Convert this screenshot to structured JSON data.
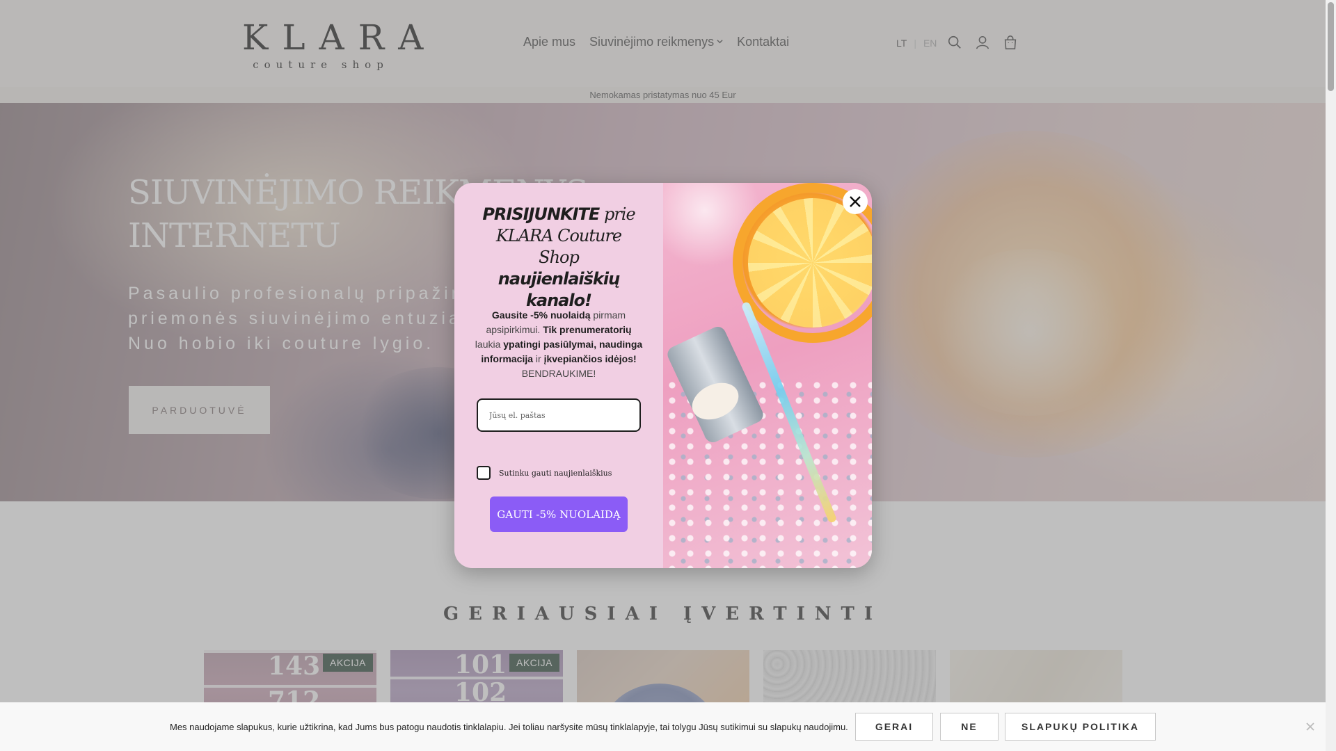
{
  "header": {
    "logo_main": "KLARA",
    "logo_sub": "couture shop",
    "nav": [
      "Apie mus",
      "Siuvinėjimo reikmenys",
      "Kontaktai"
    ],
    "lang_lt": "LT",
    "lang_en": "EN"
  },
  "announcement": "Nemokamas pristatymas nuo 45 Eur",
  "hero": {
    "title_line1": "SIUVINĖJIMO REIKMENYS",
    "title_line2": "INTERNETU",
    "sub_line1": "Pasaulio profesionalų pripažintos",
    "sub_line2": "priemonės siuvinėjimo entuziastams.",
    "sub_line3": "Nuo hobio iki couture lygio.",
    "button": "PARDUOTUVĖ"
  },
  "section": {
    "title": "GERIAUSIAI ĮVERTINTI",
    "products": [
      {
        "badge": "AKCIJA",
        "num_top": "143",
        "num_bottom": "712"
      },
      {
        "badge": "AKCIJA",
        "num_top": "101",
        "num_bottom": "102"
      },
      {
        "badge": ""
      },
      {
        "badge": ""
      },
      {
        "badge": ""
      }
    ]
  },
  "popup": {
    "title_b1": "PRISIJUNKITE",
    "title_t1": " prie KLARA Couture Shop ",
    "title_b2": "naujienlaiškių kanalo!",
    "text_b1": "Gausite -5% nuolaidą",
    "text_t1": " pirmam apsipirkimui. ",
    "text_b2": "Tik prenumeratorių",
    "text_t2": " laukia ",
    "text_b3": "ypatingi pasiūlymai, naudinga informacija",
    "text_t3": " ir ",
    "text_b4": "įkvepiančios idėjos!",
    "text_t4": " BENDRAUKIME!",
    "email_placeholder": "Jūsų el. paštas",
    "checkbox_label": "Sutinku gauti naujienlaiškius",
    "button": "GAUTI -5% NUOLAIDĄ"
  },
  "cookie": {
    "text": "Mes naudojame slapukus, kurie užtikrina, kad Jums bus patogu naudotis tinklalapiu. Jei toliau naršysite mūsų tinklalapyje, tai tolygu Jūsų sutikimui su slapukų naudojimu.",
    "accept": "GERAI",
    "reject": "NE",
    "policy": "SLAPUKŲ POLITIKA"
  },
  "colors": {
    "popup_button": "#8b5cf6",
    "popup_bg": "#f1cfe3",
    "badge": "#2f4a3c"
  },
  "icons": [
    "search-icon",
    "user-icon",
    "bag-icon",
    "close-icon",
    "chevron-down-icon"
  ]
}
